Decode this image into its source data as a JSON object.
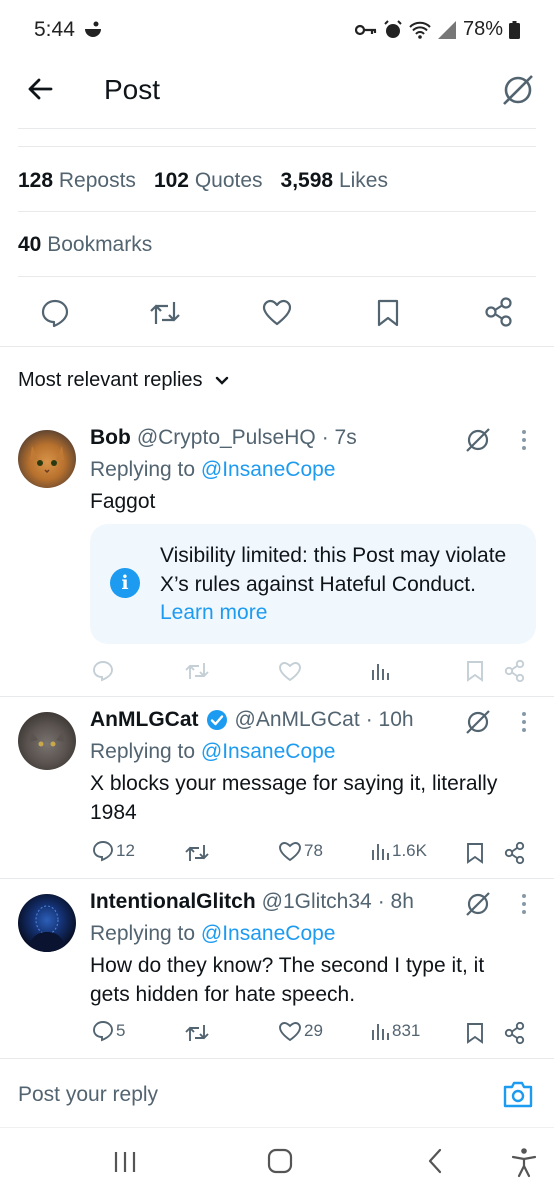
{
  "status_bar": {
    "time": "5:44",
    "battery": "78%"
  },
  "header": {
    "title": "Post"
  },
  "stats": {
    "reposts_count": "128",
    "reposts_label": "Reposts",
    "quotes_count": "102",
    "quotes_label": "Quotes",
    "likes_count": "3,598",
    "likes_label": "Likes",
    "bookmarks_count": "40",
    "bookmarks_label": "Bookmarks"
  },
  "replies_sort": {
    "label": "Most relevant replies"
  },
  "replies": [
    {
      "name": "Bob",
      "handle": "@Crypto_PulseHQ",
      "time": "· 7s",
      "replying_prefix": "Replying to",
      "replying_to": "@InsaneCope",
      "text": "Faggot",
      "notice_text": "Visibility limited: this Post may violate X’s rules against Hateful Conduct.",
      "notice_link": "Learn more"
    },
    {
      "name": "AnMLGCat",
      "verified": true,
      "handle": "@AnMLGCat",
      "time": "· 10h",
      "replying_prefix": "Replying to",
      "replying_to": "@InsaneCope",
      "text_line1": "X blocks your message for saying it, literally",
      "text_line2": "1984",
      "replies_count": "12",
      "likes_count": "78",
      "views_count": "1.6K"
    },
    {
      "name": "IntentionalGlitch",
      "handle": "@1Glitch34",
      "time": "· 8h",
      "replying_prefix": "Replying to",
      "replying_to": "@InsaneCope",
      "text_line1": "How do they know? The second I type it, it",
      "text_line2": "gets hidden for hate speech.",
      "replies_count": "5",
      "likes_count": "29",
      "views_count": "831"
    }
  ],
  "composer": {
    "placeholder": "Post your reply"
  },
  "colors": {
    "accent": "#1d9bf0",
    "text": "#0f1419",
    "muted": "#536471",
    "notice_bg": "#f0f7fd"
  }
}
